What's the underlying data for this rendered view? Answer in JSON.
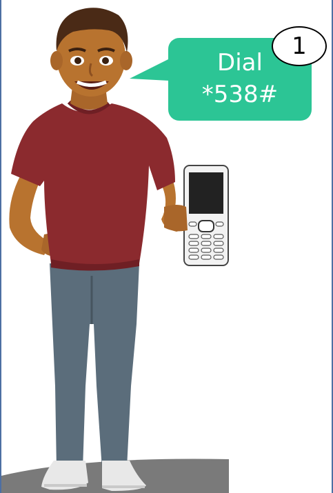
{
  "instruction_bubble": {
    "line1": "Dial",
    "line2": "*538#"
  },
  "step_badge": {
    "number": "1"
  },
  "colors": {
    "bubble": "#2cc595",
    "frame_border": "#4d6fa3",
    "shirt": "#8b2a2e",
    "jeans": "#5b6d7b",
    "skin": "#b8732f",
    "hair": "#4a2a16",
    "floor": "#7a7a7a"
  },
  "icons": {
    "phone": "feature-phone-icon"
  }
}
